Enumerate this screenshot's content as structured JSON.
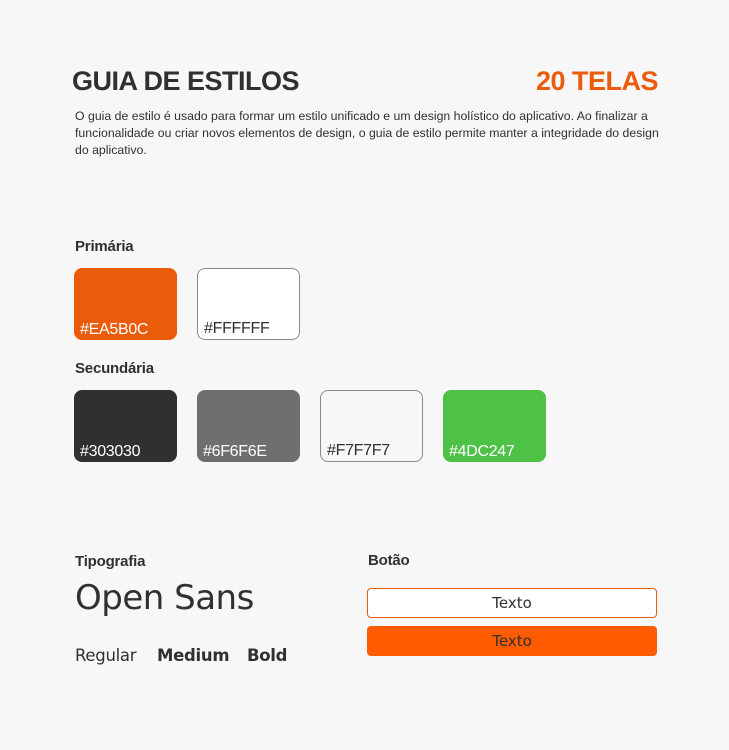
{
  "header": {
    "title": "GUIA DE ESTILOS",
    "screens": "20 TELAS",
    "description": "O guia de estilo é usado para formar um estilo unificado e um design holístico do aplicativo. Ao finalizar a funcionalidade ou criar novos elementos de design, o guia de estilo permite manter a integridade do design do aplicativo."
  },
  "colors": {
    "primary_label": "Primária",
    "primary": [
      {
        "hex": "#EA5B0C",
        "fill": "#EA5B0C"
      },
      {
        "hex": "#FFFFFF",
        "fill": "#FFFFFF"
      }
    ],
    "secondary_label": "Secundária",
    "secondary": [
      {
        "hex": "#303030",
        "fill": "#303030"
      },
      {
        "hex": "#6F6F6E",
        "fill": "#6F6F6E"
      },
      {
        "hex": "#F7F7F7",
        "fill": "#F7F7F7"
      },
      {
        "hex": "#4DC247",
        "fill": "#4DC247"
      }
    ]
  },
  "typography": {
    "label": "Tipografia",
    "font_name": "Open Sans",
    "weights": [
      "Regular",
      "Medium",
      "Bold"
    ]
  },
  "buttons": {
    "label": "Botão",
    "outline_text": "Texto",
    "filled_text": "Texto",
    "outline_border_color": "#EA5B0C",
    "filled_color": "#FF5C00"
  }
}
